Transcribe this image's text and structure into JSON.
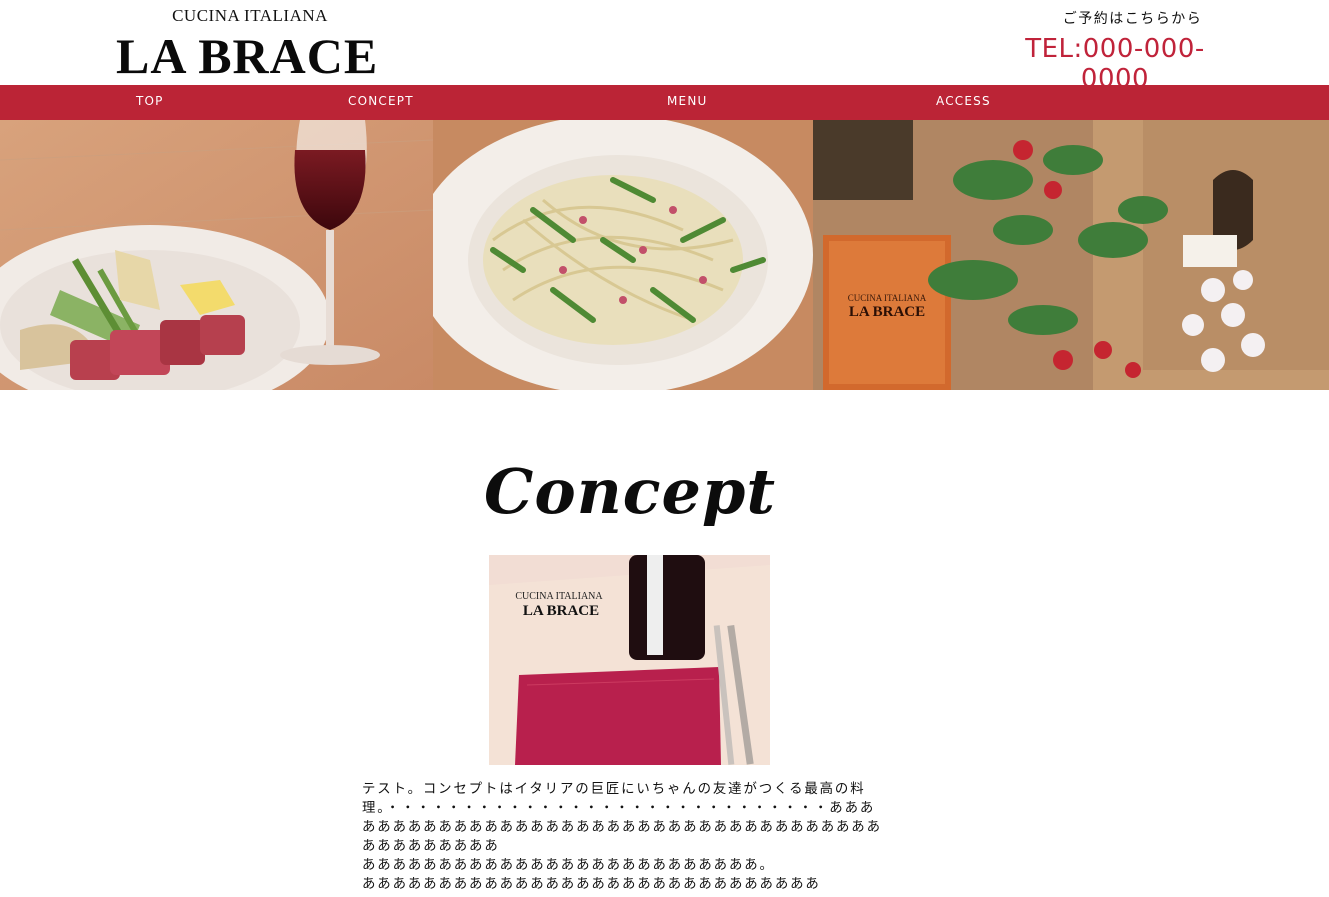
{
  "header": {
    "logo_sub": "CUCINA ITALIANA",
    "logo_main": "LA BRACE",
    "reservation_label": "ご予約はこちらから",
    "tel": "TEL:000-000-0000"
  },
  "nav": {
    "items": [
      {
        "label": "TOP"
      },
      {
        "label": "CONCEPT"
      },
      {
        "label": "MENU"
      },
      {
        "label": "ACCESS"
      }
    ]
  },
  "hero": {
    "photo_sign_sub": "CUCINA ITALIANA",
    "photo_sign_main": "LA BRACE"
  },
  "concept": {
    "title": "Concept",
    "photo_sign_sub": "CUCINA ITALIANA",
    "photo_sign_main": "LA BRACE",
    "text": "テスト。コンセプトはイタリアの巨匠にいちゃんの友達がつくる最高の料理。・・・・・・・・・・・・・・・・・・・・・・・・・・・・・ああああああああああああああああああああああああああああああああああああああああああああああ\nああああああああああああああああああああああああああ。\nああああああああああああああああああああああああああああああ"
  },
  "colors": {
    "accent": "#bb2436",
    "tel": "#c0233a"
  }
}
